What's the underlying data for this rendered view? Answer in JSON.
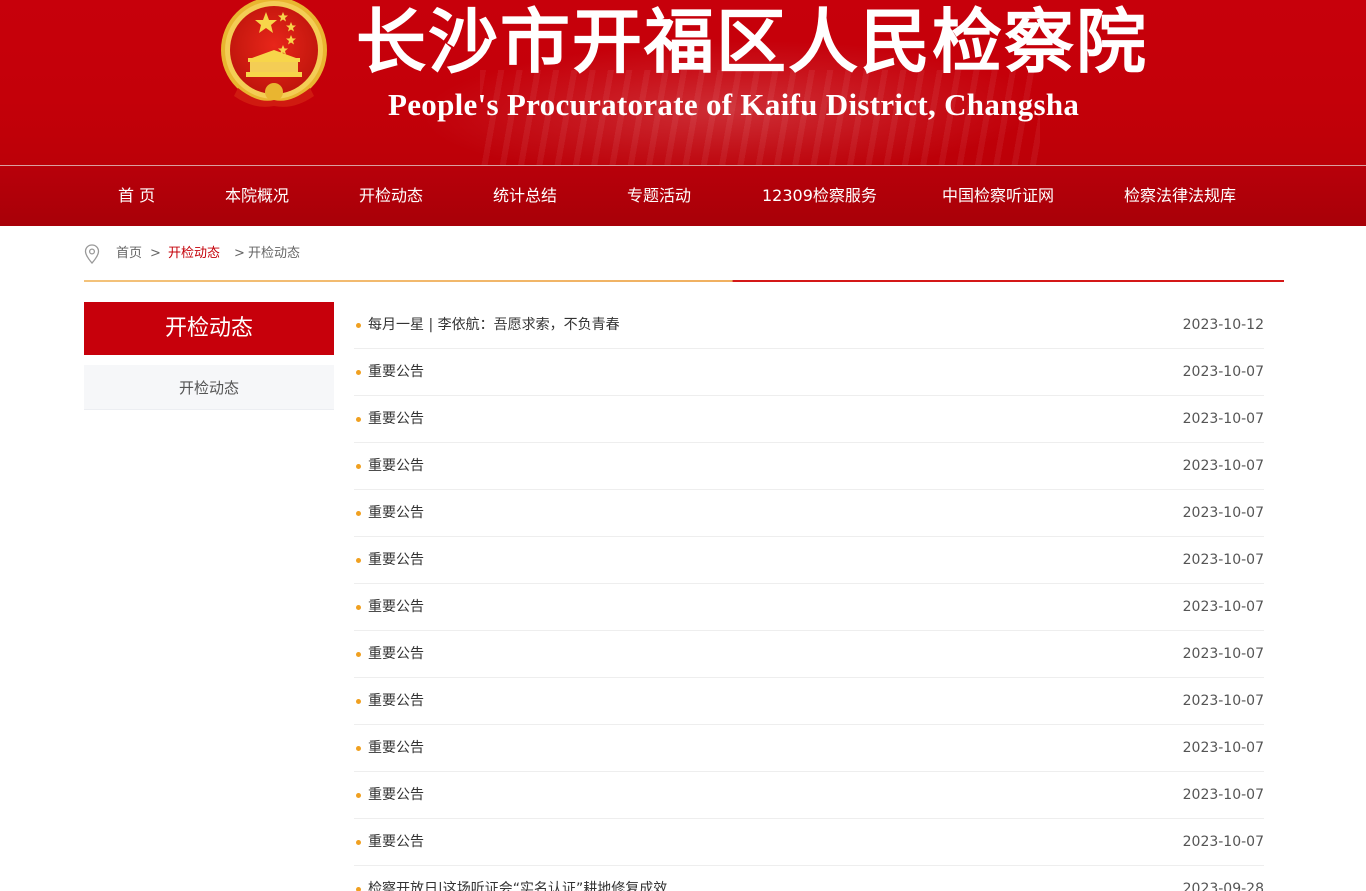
{
  "header": {
    "title_cn": "长沙市开福区人民检察院",
    "title_en": "People's Procuratorate of Kaifu District, Changsha",
    "emblem_icon": "national-emblem-icon"
  },
  "nav": {
    "items": [
      {
        "label": "首 页"
      },
      {
        "label": "本院概况"
      },
      {
        "label": "开检动态"
      },
      {
        "label": "统计总结"
      },
      {
        "label": "专题活动"
      },
      {
        "label": "12309检察服务"
      },
      {
        "label": "中国检察听证网"
      },
      {
        "label": "检察法律法规库"
      }
    ]
  },
  "breadcrumb": {
    "icon": "location-pin-icon",
    "home": "首页",
    "sep1": ">",
    "section": "开检动态",
    "sep2": ">",
    "current": "开检动态"
  },
  "sidebar": {
    "title": "开检动态",
    "items": [
      {
        "label": "开检动态"
      }
    ]
  },
  "list": {
    "items": [
      {
        "title": "每月一星 | 李依航：吾愿求索，不负青春",
        "date": "2023-10-12"
      },
      {
        "title": "重要公告",
        "date": "2023-10-07"
      },
      {
        "title": "重要公告",
        "date": "2023-10-07"
      },
      {
        "title": "重要公告",
        "date": "2023-10-07"
      },
      {
        "title": "重要公告",
        "date": "2023-10-07"
      },
      {
        "title": "重要公告",
        "date": "2023-10-07"
      },
      {
        "title": "重要公告",
        "date": "2023-10-07"
      },
      {
        "title": "重要公告",
        "date": "2023-10-07"
      },
      {
        "title": "重要公告",
        "date": "2023-10-07"
      },
      {
        "title": "重要公告",
        "date": "2023-10-07"
      },
      {
        "title": "重要公告",
        "date": "2023-10-07"
      },
      {
        "title": "重要公告",
        "date": "2023-10-07"
      },
      {
        "title": "检察开放日|这场听证会“实名认证”耕地修复成效",
        "date": "2023-09-28"
      }
    ]
  },
  "colors": {
    "brand_red": "#c7000b",
    "bullet_orange": "#f0a020"
  }
}
